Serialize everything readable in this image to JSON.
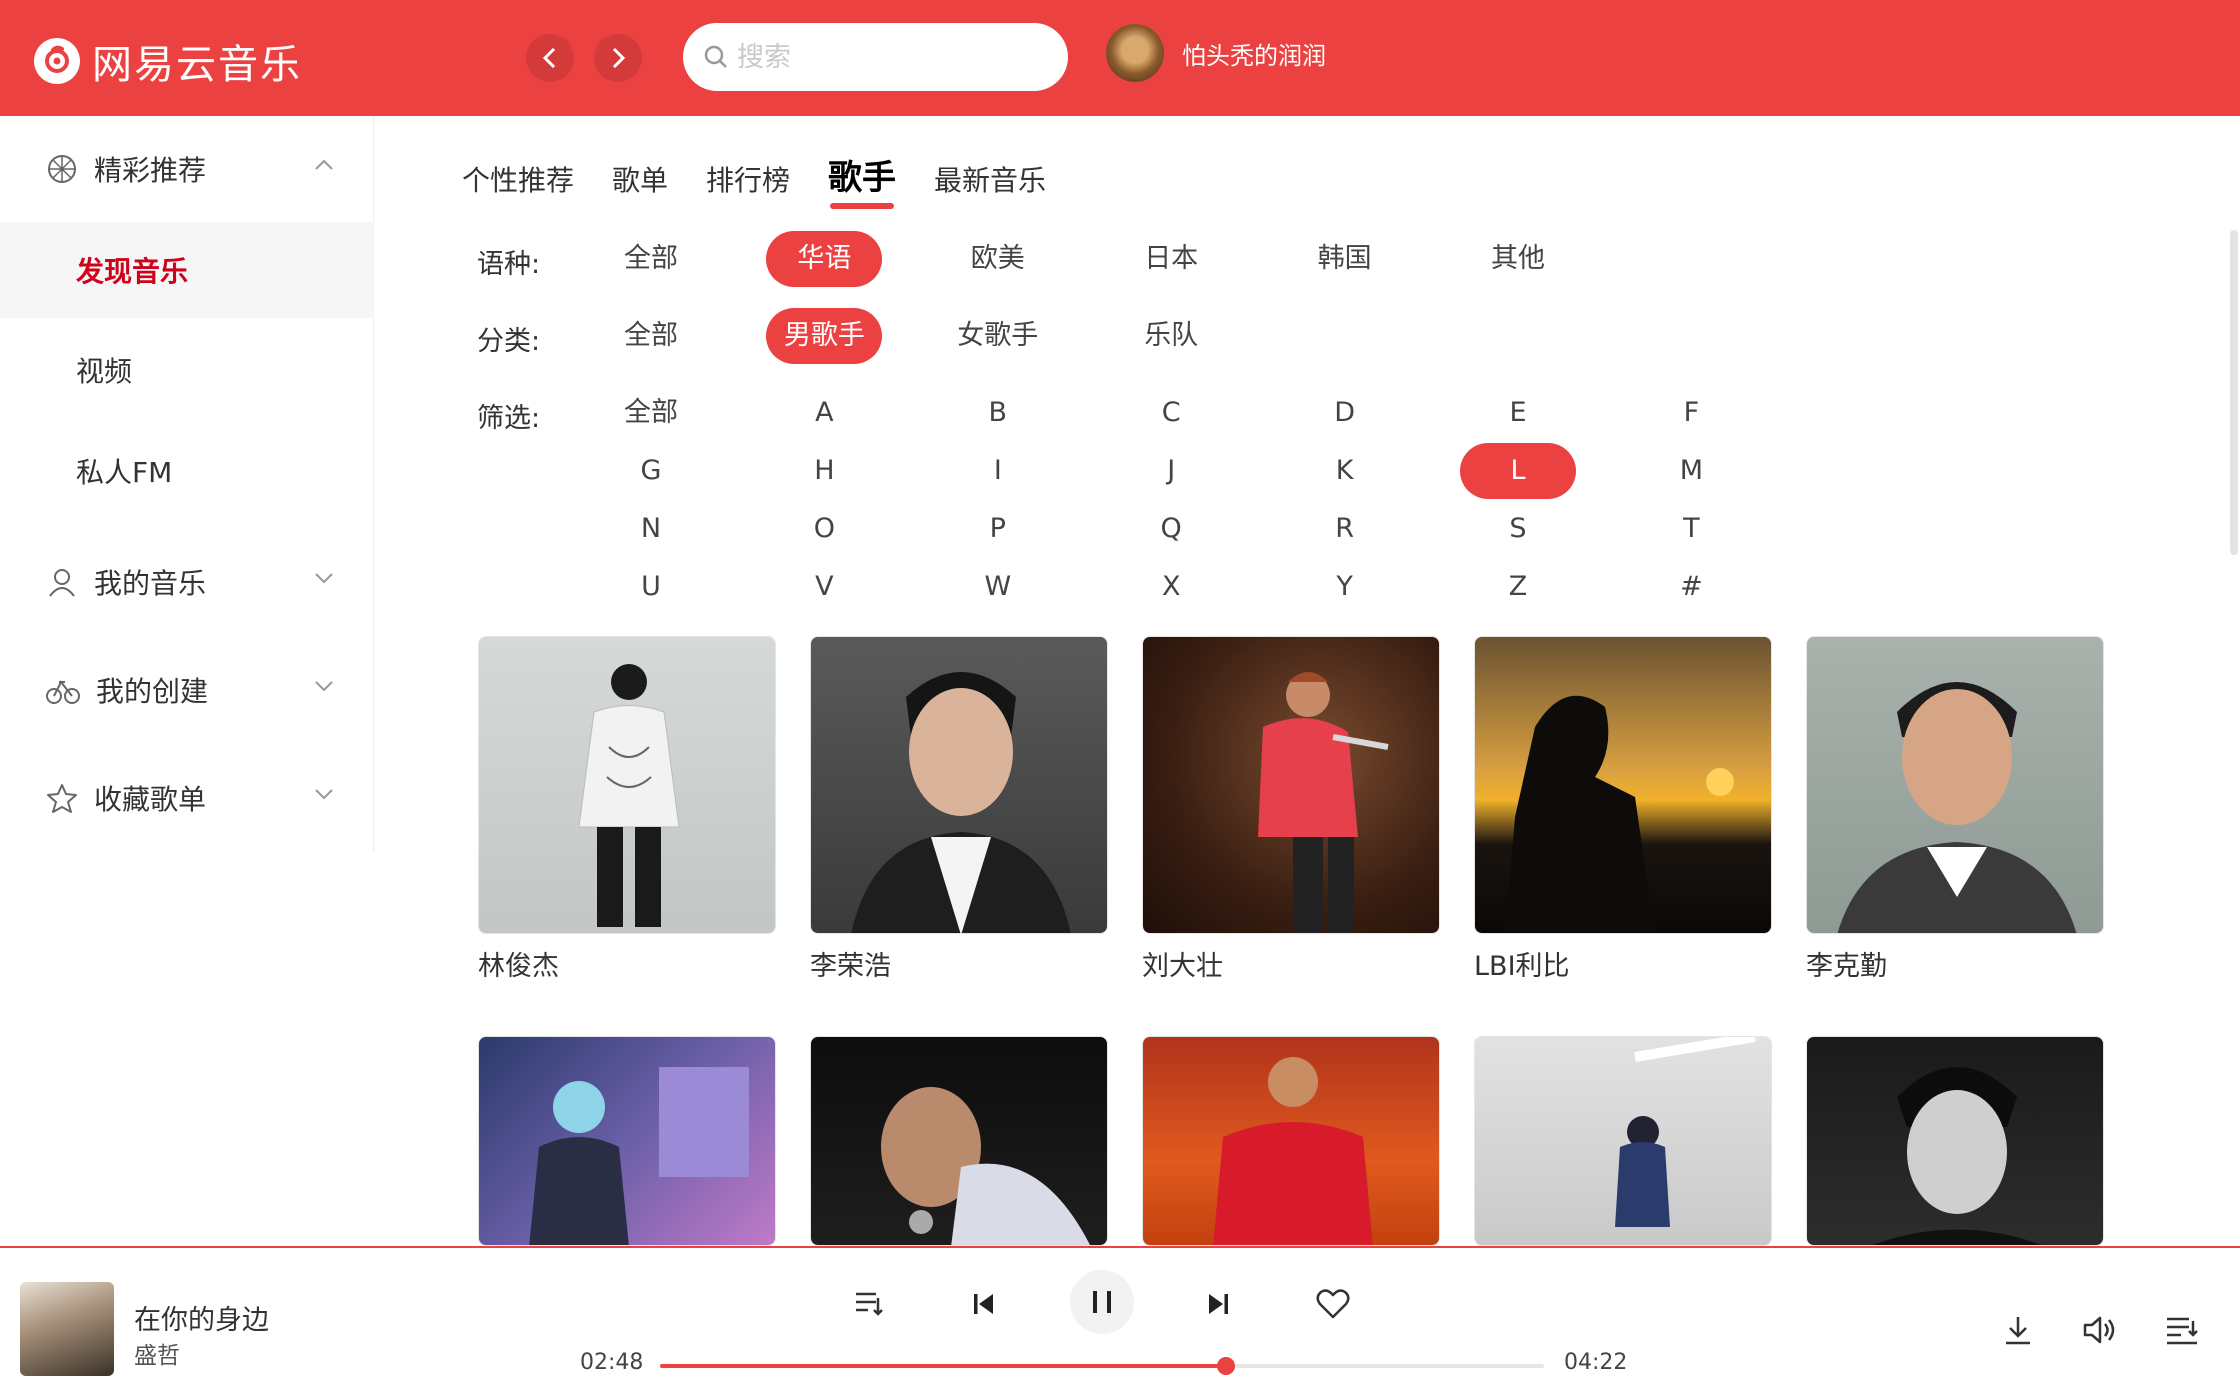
{
  "app": {
    "title": "网易云音乐",
    "brand_color": "#ec4141"
  },
  "header": {
    "search_placeholder": "搜索",
    "username": "怕头秃的润润"
  },
  "sidebar": {
    "group_recommend": "精彩推荐",
    "items": [
      "发现音乐",
      "视频",
      "私人FM"
    ],
    "group_my_music": "我的音乐",
    "group_created": "我的创建",
    "group_collected": "收藏歌单"
  },
  "tabs": [
    "个性推荐",
    "歌单",
    "排行榜",
    "歌手",
    "最新音乐"
  ],
  "active_tab": "歌手",
  "filters": {
    "language_label": "语种:",
    "languages": [
      "全部",
      "华语",
      "欧美",
      "日本",
      "韩国",
      "其他"
    ],
    "language_selected": "华语",
    "category_label": "分类:",
    "categories": [
      "全部",
      "男歌手",
      "女歌手",
      "乐队"
    ],
    "category_selected": "男歌手",
    "initial_label": "筛选:",
    "initials": [
      "全部",
      "A",
      "B",
      "C",
      "D",
      "E",
      "F",
      "G",
      "H",
      "I",
      "J",
      "K",
      "L",
      "M",
      "N",
      "O",
      "P",
      "Q",
      "R",
      "S",
      "T",
      "U",
      "V",
      "W",
      "X",
      "Y",
      "Z",
      "#"
    ],
    "initial_selected": "L"
  },
  "artists": [
    "林俊杰",
    "李荣浩",
    "刘大壮",
    "LBI利比",
    "李克勤"
  ],
  "player": {
    "song_title": "在你的身边",
    "artist": "盛哲",
    "current_time": "02:48",
    "total_time": "04:22",
    "progress_fraction": 0.64
  }
}
